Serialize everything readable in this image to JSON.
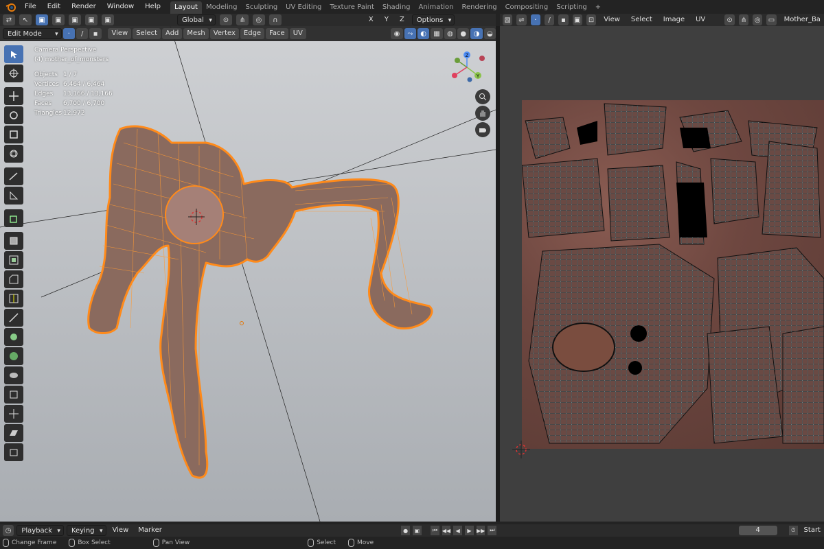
{
  "topbar": {
    "menus": [
      "File",
      "Edit",
      "Render",
      "Window",
      "Help"
    ],
    "workspaces": [
      "Layout",
      "Modeling",
      "Sculpting",
      "UV Editing",
      "Texture Paint",
      "Shading",
      "Animation",
      "Rendering",
      "Compositing",
      "Scripting"
    ],
    "active_workspace": "Layout",
    "add_tab": "+"
  },
  "header3d": {
    "transform_orientation": "Global",
    "options": "Options",
    "axes": [
      "X",
      "Y",
      "Z"
    ]
  },
  "viewport_header": {
    "mode": "Edit Mode",
    "menus": [
      "View",
      "Select",
      "Add",
      "Mesh",
      "Vertex",
      "Edge",
      "Face",
      "UV"
    ]
  },
  "viewport_info": {
    "view_name": "Camera Perspective",
    "object_name": "(4) mother_of_monsters",
    "stats": [
      {
        "label": "Objects",
        "value": "1 / 7"
      },
      {
        "label": "Vertices",
        "value": "6,464 / 6,464"
      },
      {
        "label": "Edges",
        "value": "13,166 / 13,166"
      },
      {
        "label": "Faces",
        "value": "6,700 / 6,700"
      },
      {
        "label": "Triangles",
        "value": "12,972"
      }
    ]
  },
  "gizmo": {
    "z": "Z",
    "y": "Y"
  },
  "uv_header": {
    "menus": [
      "View",
      "Select",
      "Image",
      "UV"
    ],
    "image_name": "Mother_Ba"
  },
  "timeline": {
    "menus": [
      "Playback",
      "Keying",
      "View",
      "Marker"
    ],
    "current_frame": "4",
    "start_label": "Start"
  },
  "statusbar": {
    "items": [
      "Change Frame",
      "Box Select",
      "Pan View",
      "Select",
      "Move"
    ]
  },
  "colors": {
    "accent": "#4772b3",
    "selection": "#ff8a1a",
    "viewport_bg": "#bcc0c4",
    "uv_bg": "#3f3f3f"
  }
}
